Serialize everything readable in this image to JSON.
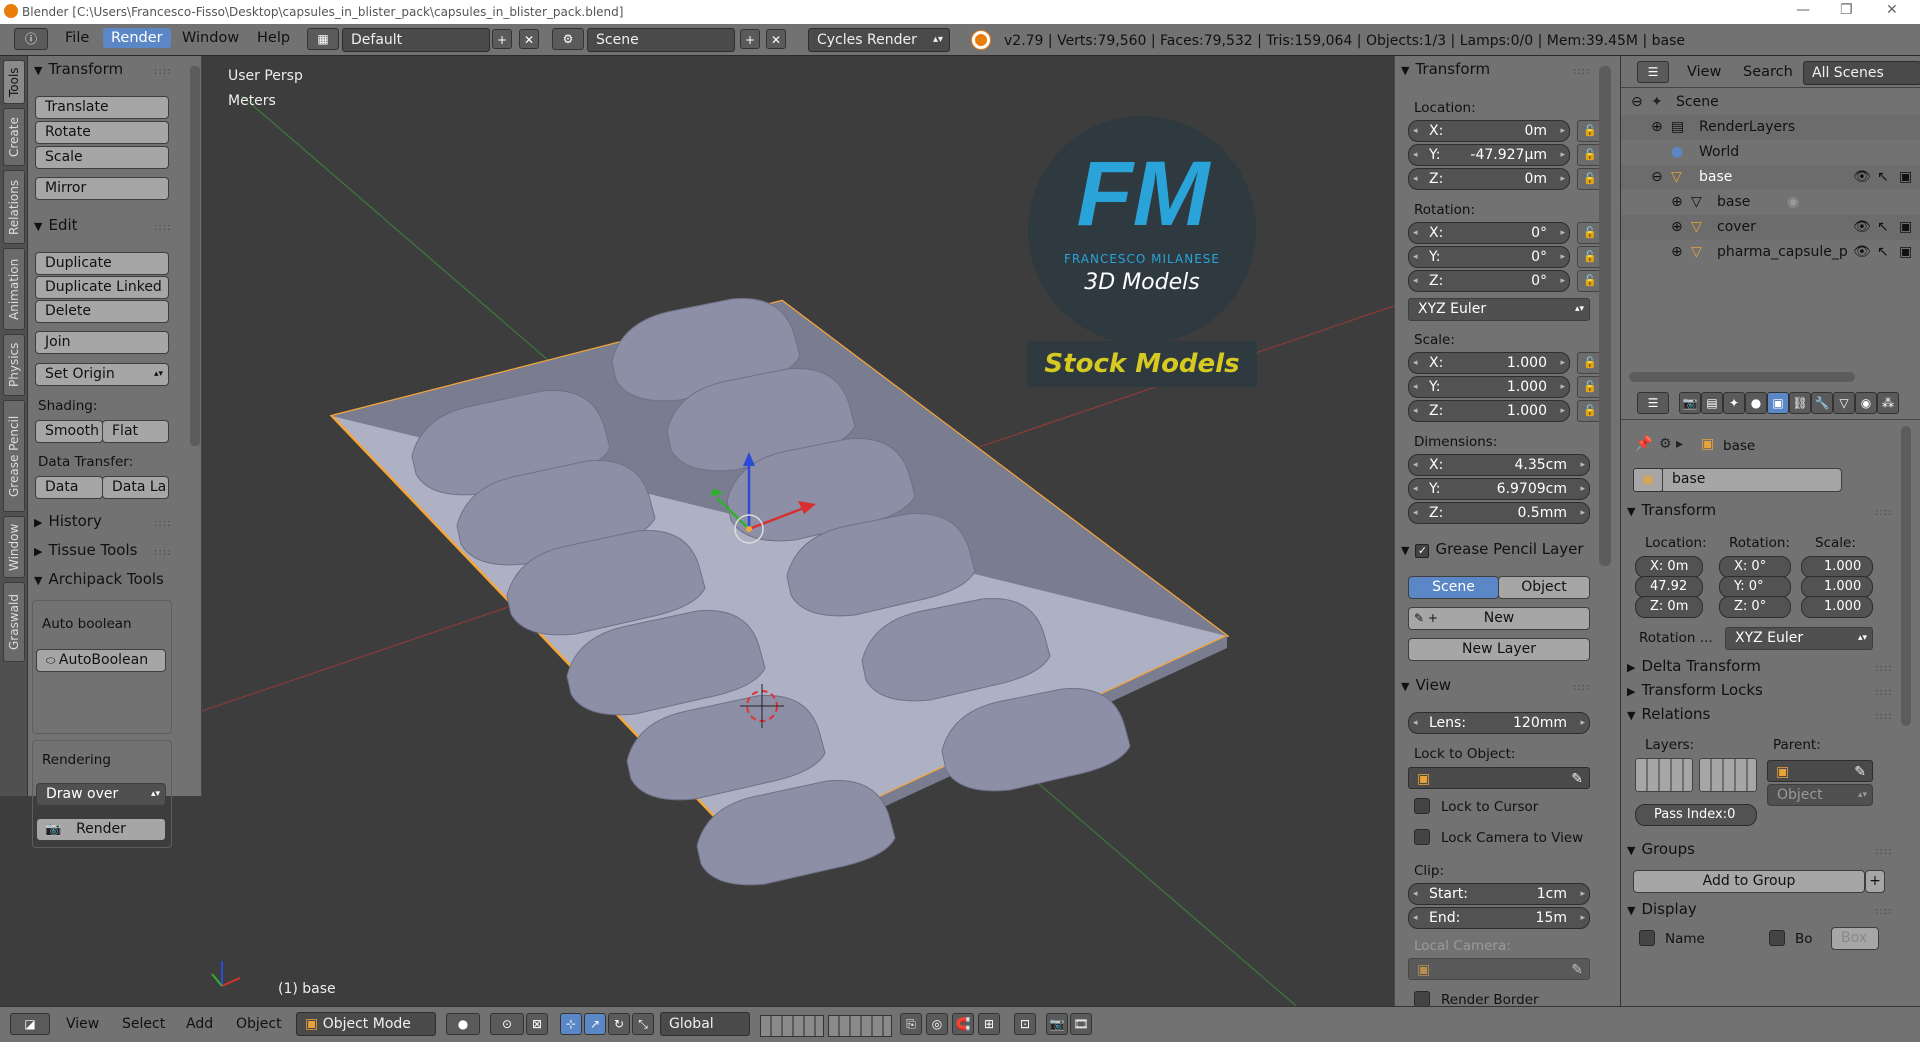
{
  "titlebar": {
    "title": "Blender [C:\\Users\\Francesco-Fisso\\Desktop\\capsules_in_blister_pack\\capsules_in_blister_pack.blend]",
    "minimize": "—",
    "restore": "❐",
    "close": "✕"
  },
  "menubar": {
    "menus": [
      "File",
      "Render",
      "Window",
      "Help"
    ],
    "layout": "Default",
    "scene": "Scene",
    "engine": "Cycles Render",
    "info": "v2.79 | Verts:79,560 | Faces:79,532 | Tris:159,064 | Objects:1/3 | Lamps:0/0 | Mem:39.45M | base"
  },
  "tabs": [
    "Tools",
    "Create",
    "Relations",
    "Animation",
    "Physics",
    "Grease Pencil",
    "Window",
    "Graswald"
  ],
  "toolshelf": {
    "transform_header": "Transform",
    "translate": "Translate",
    "rotate": "Rotate",
    "scale": "Scale",
    "mirror": "Mirror",
    "edit_header": "Edit",
    "duplicate": "Duplicate",
    "duplicate_linked": "Duplicate Linked",
    "delete": "Delete",
    "join": "Join",
    "set_origin": "Set Origin",
    "shading_label": "Shading:",
    "smooth": "Smooth",
    "flat": "Flat",
    "data_transfer_label": "Data Transfer:",
    "data": "Data",
    "data_la": "Data La",
    "history": "History",
    "tissue_tools": "Tissue Tools",
    "archipack_tools": "Archipack Tools",
    "auto_boolean_label": "Auto boolean",
    "autoboolean_button": "AutoBoolean",
    "rendering_label": "Rendering",
    "draw_over": "Draw over",
    "render_button": "Render"
  },
  "viewport": {
    "view_name": "User Persp",
    "units": "Meters",
    "object_label": "(1) base",
    "logo_letters": "FM",
    "logo_name": "FRANCESCO MILANESE",
    "logo_sub": "3D Models",
    "stock": "Stock Models"
  },
  "npanel": {
    "transform_header": "Transform",
    "location_label": "Location:",
    "loc": [
      {
        "axis": "X:",
        "value": "0m"
      },
      {
        "axis": "Y:",
        "value": "-47.927µm"
      },
      {
        "axis": "Z:",
        "value": "0m"
      }
    ],
    "rotation_label": "Rotation:",
    "rot": [
      {
        "axis": "X:",
        "value": "0°"
      },
      {
        "axis": "Y:",
        "value": "0°"
      },
      {
        "axis": "Z:",
        "value": "0°"
      }
    ],
    "rotation_mode": "XYZ Euler",
    "scale_label": "Scale:",
    "scale": [
      {
        "axis": "X:",
        "value": "1.000"
      },
      {
        "axis": "Y:",
        "value": "1.000"
      },
      {
        "axis": "Z:",
        "value": "1.000"
      }
    ],
    "dimensions_label": "Dimensions:",
    "dim": [
      {
        "axis": "X:",
        "value": "4.35cm"
      },
      {
        "axis": "Y:",
        "value": "6.9709cm"
      },
      {
        "axis": "Z:",
        "value": "0.5mm"
      }
    ],
    "gp_header": "Grease Pencil Layer",
    "gp_scene": "Scene",
    "gp_object": "Object",
    "gp_new": "New",
    "gp_new_layer": "New Layer",
    "view_header": "View",
    "lens_label": "Lens:",
    "lens_value": "120mm",
    "lock_to_object": "Lock to Object:",
    "lock_to_cursor": "Lock to Cursor",
    "lock_camera": "Lock Camera to View",
    "clip_label": "Clip:",
    "clip_start_label": "Start:",
    "clip_start": "1cm",
    "clip_end_label": "End:",
    "clip_end": "15m",
    "local_camera": "Local Camera:",
    "render_border": "Render Border"
  },
  "outliner": {
    "view": "View",
    "search": "Search",
    "filter": "All Scenes",
    "rows": [
      {
        "label": "Scene"
      },
      {
        "label": "RenderLayers"
      },
      {
        "label": "World"
      },
      {
        "label": "base"
      },
      {
        "label": "base"
      },
      {
        "label": "cover"
      },
      {
        "label": "pharma_capsule_p"
      }
    ]
  },
  "properties": {
    "context": "base",
    "object_name": "base",
    "transform_header": "Transform",
    "location_label": "Location:",
    "rotation_label": "Rotation:",
    "scale_label": "Scale:",
    "loc": [
      "X: 0m",
      "47.92",
      "Z: 0m"
    ],
    "rot": [
      "X:   0°",
      "Y:   0°",
      "Z:   0°"
    ],
    "scale": [
      "1.000",
      "1.000",
      "1.000"
    ],
    "rotation_mode_label": "Rotation ...",
    "rotation_mode": "XYZ Euler",
    "delta_transform": "Delta Transform",
    "transform_locks": "Transform Locks",
    "relations": "Relations",
    "layers_label": "Layers:",
    "parent_label": "Parent:",
    "parent_type": "Object",
    "pass_index": "Pass Index:0",
    "groups": "Groups",
    "add_to_group": "Add to Group",
    "display": "Display",
    "name_label": "Name",
    "bo_label": "Bo",
    "box": "Box"
  },
  "bottombar": {
    "view": "View",
    "select": "Select",
    "add": "Add",
    "object": "Object",
    "mode": "Object Mode",
    "orientation": "Global"
  },
  "colors": {
    "accent": "#5b87c6",
    "panel": "#727272",
    "viewport": "#3d3d3d",
    "selection": "#f5a63a",
    "logo_blue": "#2aa3d9",
    "stock_yellow": "#d6c91f"
  }
}
